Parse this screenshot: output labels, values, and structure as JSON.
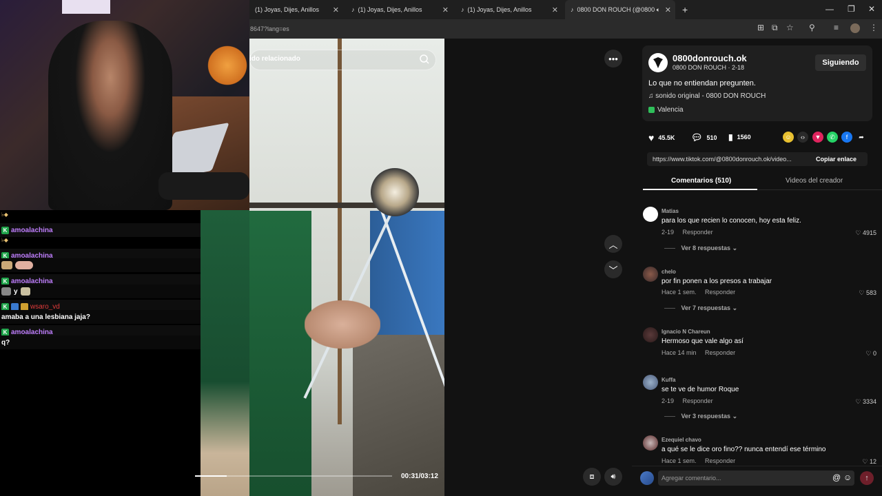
{
  "tabs": [
    {
      "label": "(1) Joyas, Dijes, Anillos"
    },
    {
      "label": "(1) Joyas, Dijes, Anillos"
    },
    {
      "label": "(1) Joyas, Dijes, Anillos"
    },
    {
      "label": "0800 DON ROUCH (@0800"
    }
  ],
  "address": {
    "url": "8647?lang=es"
  },
  "chat": {
    "emoji_line1": "♭◆",
    "emoji_line2": "♭◆",
    "rows": [
      {
        "user": "amoalachina",
        "text": ""
      },
      {
        "user": "amoalachina",
        "text": "y"
      },
      {
        "user": "wsaro_vd",
        "text": "amaba a una lesbiana jaja?"
      },
      {
        "user": "amoalachina",
        "text": "q?"
      }
    ]
  },
  "video": {
    "search_placeholder": "ido relacionado",
    "time": "00:31/03:12",
    "progress": 0.16
  },
  "creator": {
    "handle": "0800donrouch.ok",
    "sub": "0800 DON ROUCH · 2-18",
    "follow_label": "Siguiendo",
    "description": "Lo que no entiendan pregunten.",
    "sound": "sonido original - 0800 DON ROUCH",
    "location": "Valencia"
  },
  "stats": {
    "likes": "45.5K",
    "comments": "510",
    "saves": "1560"
  },
  "link": {
    "url": "https://www.tiktok.com/@0800donrouch.ok/video...",
    "copy_label": "Copiar enlace"
  },
  "panel_tabs": {
    "comments": "Comentarios (510)",
    "creator_videos": "Videos del creador"
  },
  "comments": [
    {
      "user": "Matias",
      "text": "para los que recien lo conocen, hoy esta feliz.",
      "date": "2-19",
      "reply": "Responder",
      "likes": "4915",
      "more": "Ver 8 respuestas"
    },
    {
      "user": "chelo",
      "text": "por fin ponen a los presos a trabajar",
      "date": "Hace 1 sem.",
      "reply": "Responder",
      "likes": "583",
      "more": "Ver 7 respuestas"
    },
    {
      "user": "Ignacio N Chareun",
      "text": "Hermoso que vale algo así",
      "date": "Hace 14 min",
      "reply": "Responder",
      "likes": "0",
      "more": ""
    },
    {
      "user": "Kuffa",
      "text": "se te ve de humor Roque",
      "date": "2-19",
      "reply": "Responder",
      "likes": "3334",
      "more": "Ver 3 respuestas"
    },
    {
      "user": "Ezequiel chavo",
      "text": "a qué se le dice oro fino?? nunca entendí ese término",
      "date": "Hace 1 sem.",
      "reply": "Responder",
      "likes": "12",
      "more": ""
    }
  ],
  "comment_input": {
    "placeholder": "Agregar comentario..."
  },
  "colors": {
    "accent_follow_bg": "#2f2f2f",
    "chat_username": "#c07fff",
    "chat_username_alt": "#e23b3b",
    "post_button": "#6e1f2a"
  }
}
